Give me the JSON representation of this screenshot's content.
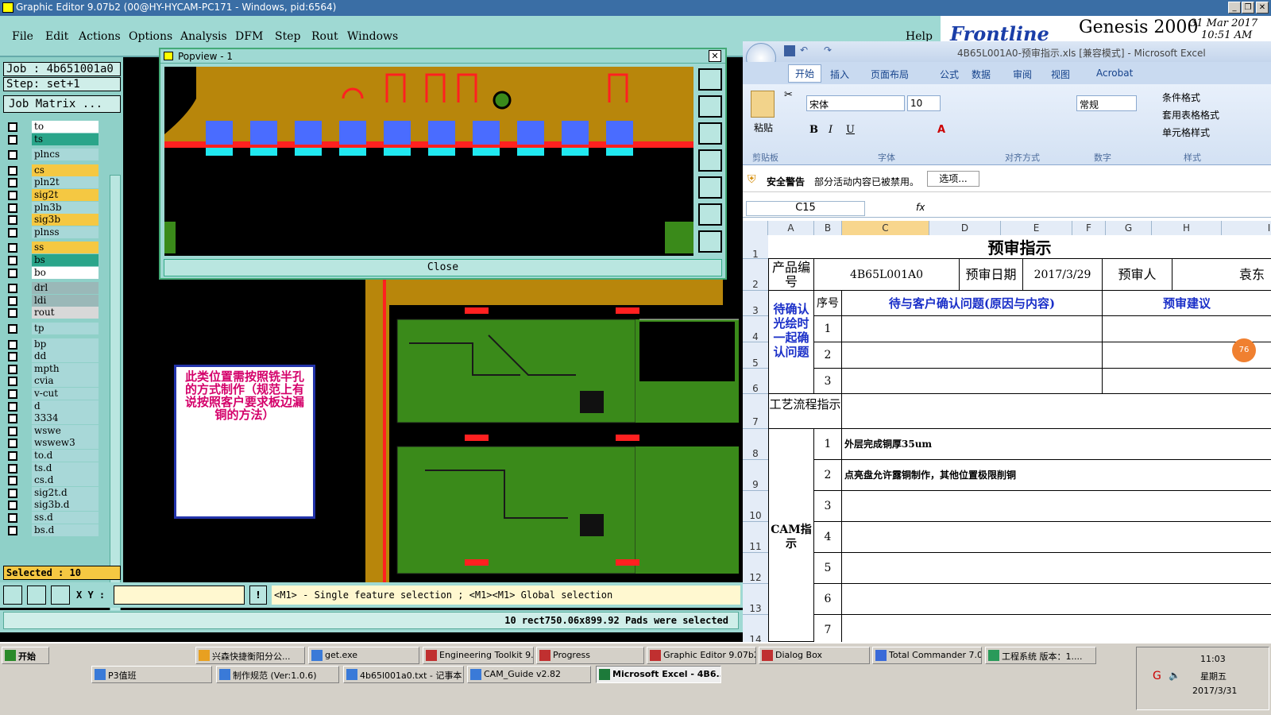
{
  "window": {
    "title": "Graphic Editor 9.07b2 (00@HY-HYCAM-PC171 - Windows, pid:6564)"
  },
  "menu": {
    "items": [
      "File",
      "Edit",
      "Actions",
      "Options",
      "Analysis",
      "DFM",
      "Step",
      "Rout",
      "Windows"
    ],
    "help": "Help"
  },
  "genesis": {
    "brand": "Frontline",
    "product": "Genesis 2000",
    "date": "31 Mar 2017",
    "time": "10:51 AM"
  },
  "job": {
    "job": "Job : 4b651001a0",
    "step": "Step: set+1",
    "matrix_button": "Job Matrix ..."
  },
  "layers": [
    {
      "name": "to",
      "color": "#ffffff"
    },
    {
      "name": "ts",
      "color": "#2aa58a"
    },
    {
      "name": "plncs",
      "color": "#a8d8d8"
    },
    {
      "name": "cs",
      "color": "#f5c842"
    },
    {
      "name": "pln2t",
      "color": "#a8d8d8"
    },
    {
      "name": "sig2t",
      "color": "#f5c842"
    },
    {
      "name": "pln3b",
      "color": "#a8d8d8"
    },
    {
      "name": "sig3b",
      "color": "#f5c842"
    },
    {
      "name": "plnss",
      "color": "#a8d8d8"
    },
    {
      "name": "ss",
      "color": "#f5c842"
    },
    {
      "name": "bs",
      "color": "#2aa58a"
    },
    {
      "name": "bo",
      "color": "#ffffff"
    },
    {
      "name": "drl",
      "color": "#9ab8b8"
    },
    {
      "name": "ldi",
      "color": "#9ab8b8"
    },
    {
      "name": "rout",
      "color": "#d8d8d8"
    },
    {
      "name": "tp",
      "color": "#a8d8d8"
    },
    {
      "name": "bp",
      "color": "#a8d8d8"
    },
    {
      "name": "dd",
      "color": "#a8d8d8"
    },
    {
      "name": "mpth",
      "color": "#a8d8d8"
    },
    {
      "name": "cvia",
      "color": "#a8d8d8"
    },
    {
      "name": "v-cut",
      "color": "#a8d8d8"
    },
    {
      "name": "d",
      "color": "#a8d8d8"
    },
    {
      "name": "3334",
      "color": "#a8d8d8"
    },
    {
      "name": "wswe",
      "color": "#a8d8d8"
    },
    {
      "name": "wswew3",
      "color": "#a8d8d8"
    },
    {
      "name": "to.d",
      "color": "#a8d8d8"
    },
    {
      "name": "ts.d",
      "color": "#a8d8d8"
    },
    {
      "name": "cs.d",
      "color": "#a8d8d8"
    },
    {
      "name": "sig2t.d",
      "color": "#a8d8d8"
    },
    {
      "name": "sig3b.d",
      "color": "#a8d8d8"
    },
    {
      "name": "ss.d",
      "color": "#a8d8d8"
    },
    {
      "name": "bs.d",
      "color": "#a8d8d8"
    }
  ],
  "selected_text": "Selected : 10",
  "popview": {
    "title": "Popview - 1",
    "close": "Close"
  },
  "note": "此类位置需按照铣半孔的方式制作（规范上有说按照客户要求板边漏铜的方法）",
  "cmd": {
    "xy_label": "X Y :",
    "xy_value": "",
    "hint": "<M1> - Single feature selection ; <M1><M1> Global selection"
  },
  "status": "10 rect750.06x899.92 Pads were selected",
  "excel": {
    "title": "4B65L001A0-预审指示.xls [兼容模式] - Microsoft Excel",
    "tabs": [
      "开始",
      "插入",
      "页面布局",
      "公式",
      "数据",
      "审阅",
      "视图",
      "Acrobat"
    ],
    "paste": "粘贴",
    "clipboard": "剪贴板",
    "font_name": "宋体",
    "font_size": "10",
    "font_group": "字体",
    "align_group": "对齐方式",
    "number_format": "常规",
    "number_group": "数字",
    "style_group": "样式",
    "cond_fmt": "条件格式",
    "table_fmt": "套用表格格式",
    "cell_style": "单元格样式",
    "security_label": "安全警告",
    "security_text": "部分活动内容已被禁用。",
    "options_btn": "选项...",
    "namebox": "C15",
    "fx": "fx",
    "cols": [
      "A",
      "B",
      "C",
      "D",
      "E",
      "F",
      "G",
      "H",
      "I"
    ],
    "rows": [
      "1",
      "2",
      "3",
      "4",
      "5",
      "6",
      "7",
      "8",
      "9",
      "10",
      "11",
      "12",
      "13",
      "14"
    ],
    "sheet_title": "预审指示",
    "prod_no_label": "产品编号",
    "prod_no": "4B65L001A0",
    "review_date_label": "预审日期",
    "review_date": "2017/3/29",
    "reviewer_label": "预审人",
    "reviewer": "袁东",
    "seq": "序号",
    "issue_hdr": "待与客户确认问题(原因与内容)",
    "suggest_hdr": "预审建议",
    "pending_label": "待确认光绘时一起确认问题",
    "process_label": "工艺流程指示",
    "cam_label": "CAM指示",
    "cam_items": [
      {
        "no": "1",
        "text": "外层完成铜厚35um"
      },
      {
        "no": "2",
        "text": "点亮盘允许露铜制作，其他位置极限削铜"
      },
      {
        "no": "3",
        "text": ""
      },
      {
        "no": "4",
        "text": ""
      },
      {
        "no": "5",
        "text": ""
      },
      {
        "no": "6",
        "text": ""
      },
      {
        "no": "7",
        "text": ""
      }
    ],
    "badge": "76"
  },
  "taskbar": {
    "start": "开始",
    "row1": [
      "兴森快捷衡阳分公...",
      "get.exe",
      "Engineering Toolkit 9....",
      "Progress",
      "Graphic Editor 9.07b2...",
      "Dialog Box",
      "Total Commander 7.0...",
      "工程系统  版本：1...."
    ],
    "row2": [
      "P3值班",
      "制作规范 (Ver:1.0.6)",
      "4b65l001a0.txt - 记事本",
      "CAM_Guide v2.82",
      "Microsoft Excel - 4B6..."
    ],
    "clock_time": "11:03",
    "clock_day": "星期五",
    "clock_date": "2017/3/31"
  }
}
